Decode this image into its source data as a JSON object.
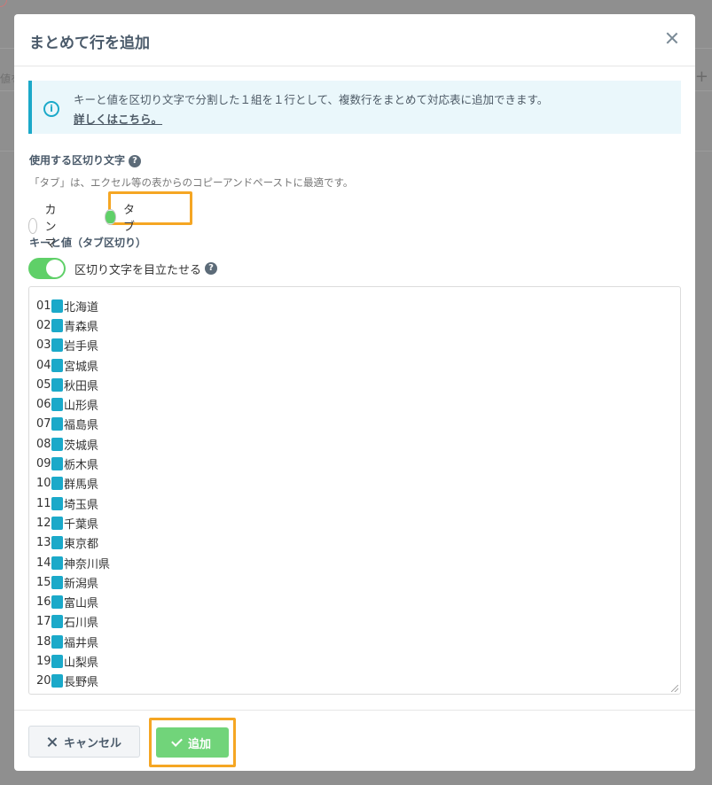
{
  "background": {
    "left_hint": "値を",
    "right_hint": "+"
  },
  "modal": {
    "title": "まとめて行を追加",
    "info": {
      "text": "キーと値を区切り文字で分割した１組を１行として、複数行をまとめて対応表に追加できます。",
      "link": "詳しくはこちら。"
    },
    "delimiter": {
      "label": "使用する区切り文字",
      "description": "「タブ」は、エクセル等の表からのコピーアンドペーストに最適です。",
      "options": [
        {
          "label": "カンマ",
          "checked": false
        },
        {
          "label": "タブ",
          "checked": true
        }
      ]
    },
    "kv_label": "キーと値（タブ区切り）",
    "toggle_label": "区切り文字を目立たせる",
    "toggle_on": true,
    "rows": [
      {
        "key": "01",
        "value": "北海道"
      },
      {
        "key": "02",
        "value": "青森県"
      },
      {
        "key": "03",
        "value": "岩手県"
      },
      {
        "key": "04",
        "value": "宮城県"
      },
      {
        "key": "05",
        "value": "秋田県"
      },
      {
        "key": "06",
        "value": "山形県"
      },
      {
        "key": "07",
        "value": "福島県"
      },
      {
        "key": "08",
        "value": "茨城県"
      },
      {
        "key": "09",
        "value": "栃木県"
      },
      {
        "key": "10",
        "value": "群馬県"
      },
      {
        "key": "11",
        "value": "埼玉県"
      },
      {
        "key": "12",
        "value": "千葉県"
      },
      {
        "key": "13",
        "value": "東京都"
      },
      {
        "key": "14",
        "value": "神奈川県"
      },
      {
        "key": "15",
        "value": "新潟県"
      },
      {
        "key": "16",
        "value": "富山県"
      },
      {
        "key": "17",
        "value": "石川県"
      },
      {
        "key": "18",
        "value": "福井県"
      },
      {
        "key": "19",
        "value": "山梨県"
      },
      {
        "key": "20",
        "value": "長野県"
      }
    ],
    "footer": {
      "cancel_label": "キャンセル",
      "add_label": "追加"
    }
  },
  "colors": {
    "accent": "#1ba9c9",
    "green": "#5fd068",
    "highlight": "#f5a623"
  }
}
